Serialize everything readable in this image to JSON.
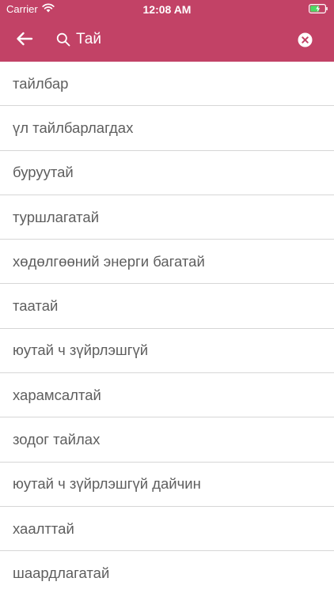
{
  "status_bar": {
    "carrier": "Carrier",
    "time": "12:08 AM",
    "wifi_icon": "wifi-icon",
    "battery_icon": "battery-charging-icon"
  },
  "toolbar": {
    "background_color": "#c24266",
    "back_icon": "arrow-left-icon",
    "search_icon": "search-icon",
    "search_value": "Тай",
    "clear_icon": "clear-circle-icon"
  },
  "results": [
    "тайлбар",
    "үл тайлбарлагдах",
    "буруутай",
    "туршлагатай",
    "хөдөлгөөний энерги багатай",
    "таатай",
    "юутай ч зүйрлэшгүй",
    "харамсалтай",
    "зодог тайлах",
    "юутай ч зүйрлэшгүй дайчин",
    "хаалттай",
    "шаардлагатай"
  ]
}
